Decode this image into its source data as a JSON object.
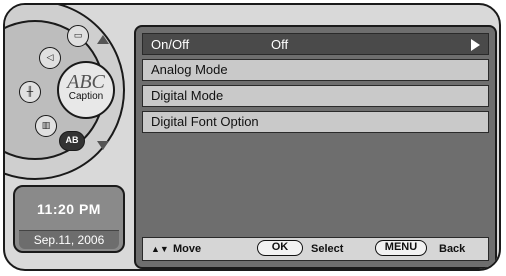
{
  "dial": {
    "icons": [
      "menu-icon",
      "speaker-icon",
      "equalizer-icon",
      "picture-icon",
      "lock-icon"
    ],
    "caption_knob": {
      "abc": "ABC",
      "label": "Caption"
    },
    "ab_badge": "AB"
  },
  "clock": {
    "time": "11:20 PM",
    "date": "Sep.11, 2006"
  },
  "menu": {
    "onoff": {
      "label": "On/Off",
      "value": "Off"
    },
    "items": [
      {
        "label": "Analog Mode"
      },
      {
        "label": "Digital Mode"
      },
      {
        "label": "Digital Font Option"
      }
    ]
  },
  "footer": {
    "move_symbol": "▲▼",
    "move": "Move",
    "ok_key": "OK",
    "select": "Select",
    "menu_key": "MENU",
    "back": "Back"
  },
  "colors": {
    "panel_bg": "#6e6e6e",
    "item_bg": "#c9c9c9",
    "highlight_bg": "#4a4a4a"
  }
}
